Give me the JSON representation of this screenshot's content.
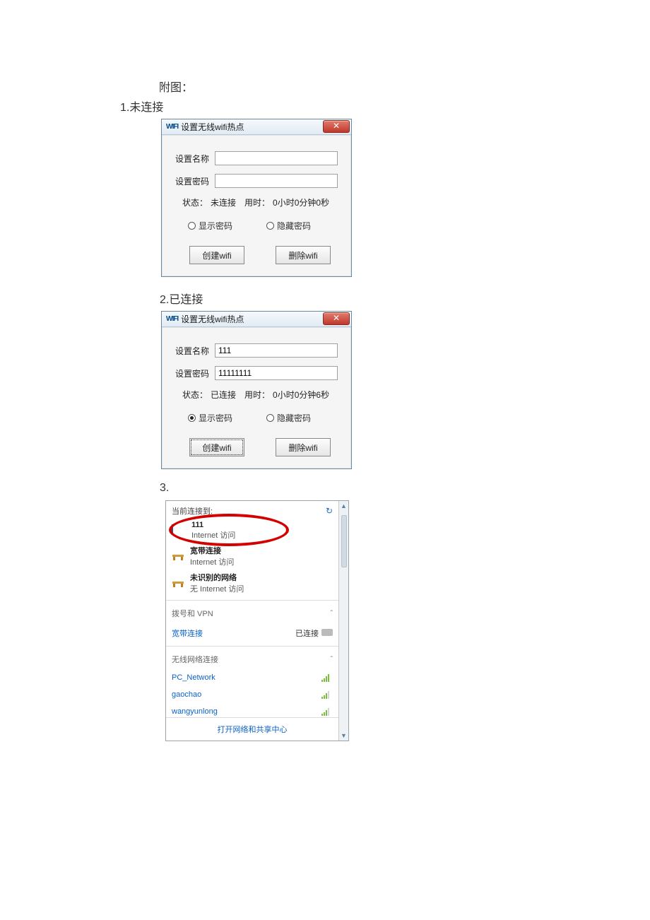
{
  "doc": {
    "attachment_label": "附图：",
    "section1": "1.未连接",
    "section2": "2.已连接",
    "section3": "3."
  },
  "dialog": {
    "app_icon": "WIFI",
    "title": "设置无线wifi热点",
    "close": "✕",
    "name_label": "设置名称",
    "pwd_label": "设置密码",
    "status_label": "状态：",
    "time_label": "用时：",
    "show_pwd": "显示密码",
    "hide_pwd": "隐藏密码",
    "create_btn": "创建wifi",
    "delete_btn": "删除wifi"
  },
  "state1": {
    "name_value": "",
    "pwd_value": "",
    "status_value": "未连接",
    "time_value": "0小时0分钟0秒",
    "show_checked": false,
    "hide_checked": false
  },
  "state2": {
    "name_value": "111",
    "pwd_value": "11111111",
    "status_value": "已连接",
    "time_value": "0小时0分钟6秒",
    "show_checked": true,
    "hide_checked": false
  },
  "flyout": {
    "header": "当前连接到:",
    "conn1_name": "111",
    "conn1_sub": "Internet 访问",
    "conn2_name": "宽带连接",
    "conn2_sub": "Internet 访问",
    "conn3_name": "未识别的网络",
    "conn3_sub": "无 Internet 访问",
    "cat1": "拨号和 VPN",
    "cat2": "无线网络连接",
    "vpn_item": "宽带连接",
    "vpn_state": "已连接",
    "wifi1": "PC_Network",
    "wifi2": "gaochao",
    "wifi3": "wangyunlong",
    "footer": "打开网络和共享中心"
  }
}
